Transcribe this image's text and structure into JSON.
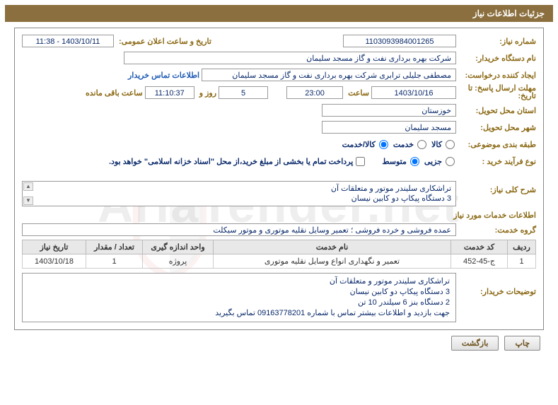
{
  "title_bar": "جزئیات اطلاعات نیاز",
  "fields": {
    "need_number_label": "شماره نیاز:",
    "need_number": "1103093984001265",
    "announce_date_label": "تاریخ و ساعت اعلان عمومی:",
    "announce_date": "1403/10/11 - 11:38",
    "buyer_org_label": "نام دستگاه خریدار:",
    "buyer_org": "شرکت بهره برداری نفت و گاز مسجد سلیمان",
    "requester_label": "ایجاد کننده درخواست:",
    "requester": "مصطفی جلیلی ترابری شرکت بهره برداری نفت و گاز مسجد سلیمان",
    "buyer_contact_link": "اطلاعات تماس خریدار",
    "deadline_label_1": "مهلت ارسال پاسخ: تا",
    "deadline_label_2": "تاریخ:",
    "deadline_date": "1403/10/16",
    "time_label": "ساعت",
    "deadline_time": "23:00",
    "days_count": "5",
    "days_unit": "روز و",
    "remaining_time": "11:10:37",
    "remaining_label": "ساعت باقی مانده",
    "province_label": "استان محل تحویل:",
    "province": "خوزستان",
    "city_label": "شهر محل تحویل:",
    "city": "مسجد سلیمان",
    "category_label": "طبقه بندی موضوعی:",
    "cat_goods": "کالا",
    "cat_service": "خدمت",
    "cat_goods_service": "کالا/خدمت",
    "process_type_label": "نوع فرآیند خرید :",
    "proc_partial": "جزیی",
    "proc_medium": "متوسط",
    "payment_note": "پرداخت تمام یا بخشی از مبلغ خرید،از محل \"اسناد خزانه اسلامی\" خواهد بود.",
    "summary_label": "شرح کلی نیاز:",
    "summary_line1": "تراشکاری سلیندر موتور و متعلقات آن",
    "summary_line2": "3 دستگاه پیکاپ دو کابین نیسان",
    "services_section": "اطلاعات خدمات مورد نیاز",
    "service_group_label": "گروه خدمت:",
    "service_group": "عمده فروشی و خرده فروشی ؛ تعمیر وسایل نقلیه موتوری و موتور سیکلت",
    "buyer_notes_label": "توضیحات خریدار:",
    "buyer_notes_l1": "تراشکاری سلیندر موتور و متعلقات آن",
    "buyer_notes_l2": "3 دستگاه پیکاپ دو کابین نیسان",
    "buyer_notes_l3": "2 دستگاه بنز 6 سیلندر 10 تن",
    "buyer_notes_l4": "جهت بازدید و اطلاعات بیشتر تماس با شماره 09163778201 تماس بگیرید"
  },
  "table": {
    "headers": {
      "row": "ردیف",
      "code": "کد خدمت",
      "name": "نام خدمت",
      "unit": "واحد اندازه گیری",
      "qty": "تعداد / مقدار",
      "date": "تاریخ نیاز"
    },
    "rows": [
      {
        "row": "1",
        "code": "ج-45-452",
        "name": "تعمیر و نگهداری انواع وسایل نقلیه موتوری",
        "unit": "پروژه",
        "qty": "1",
        "date": "1403/10/18"
      }
    ]
  },
  "buttons": {
    "print": "چاپ",
    "back": "بازگشت"
  },
  "watermark": "AriaTender.net"
}
